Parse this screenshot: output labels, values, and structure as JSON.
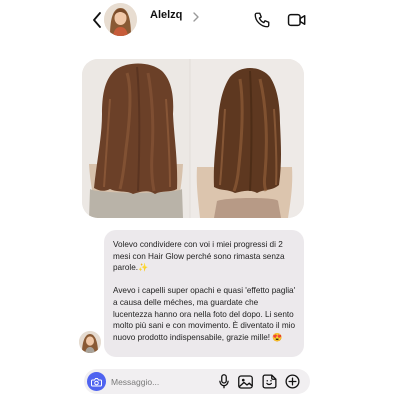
{
  "contact": {
    "name": "Alelzq"
  },
  "message": {
    "paragraph1": "Volevo condividere con voi i miei progressi di 2 mesi con Hair Glow perché sono rimasta senza parole.✨",
    "paragraph2": "Avevo i capelli super opachi e quasi 'effetto paglia' a causa delle méches, ma guardate che lucentezza hanno ora nella foto del dopo. Li sento molto più sani e con movimento. È diventato il mio nuovo prodotto indispensabile, grazie mille! 😍"
  },
  "composer": {
    "placeholder": "Messaggio..."
  },
  "icons": {
    "back": "chevron-left-icon",
    "profile": "chevron-right-icon",
    "call": "phone-icon",
    "video": "video-camera-icon",
    "camera": "camera-icon",
    "mic": "microphone-icon",
    "gallery": "image-icon",
    "sticker": "sticker-icon",
    "add": "plus-icon"
  },
  "colors": {
    "accent": "#4f63f0",
    "bubble": "#ece9ec",
    "hair": "#6a4128"
  }
}
